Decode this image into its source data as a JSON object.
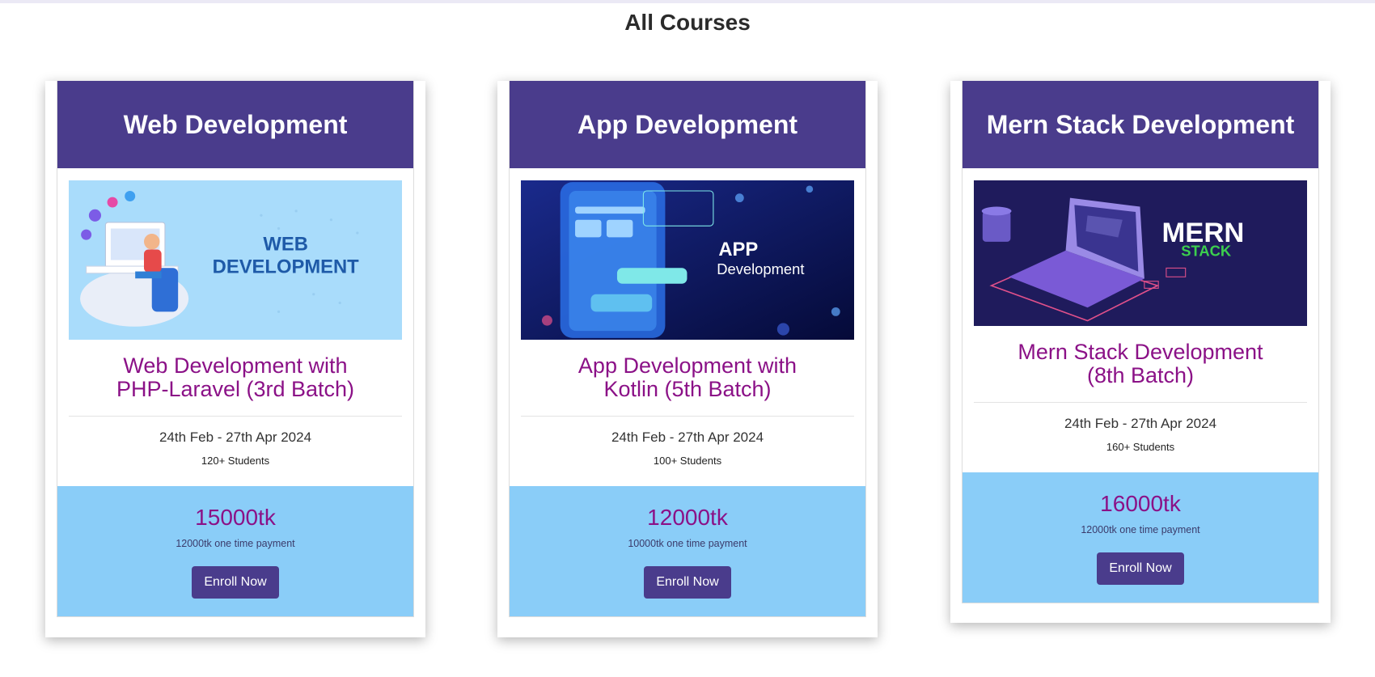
{
  "page": {
    "title": "All Courses"
  },
  "courses": [
    {
      "header": "Web Development",
      "banner": {
        "text_line1": "WEB",
        "text_line2": "DEVELOPMENT",
        "bg": "#a9dcfb",
        "text_color": "#1e5aa8"
      },
      "name_line1": "Web Development with",
      "name_line2": "PHP-Laravel (3rd Batch)",
      "dates": "24th Feb - 27th Apr 2024",
      "students": "120+ Students",
      "price": "15000tk",
      "payment": "12000tk one time payment",
      "enroll_label": "Enroll Now"
    },
    {
      "header": "App Development",
      "banner": {
        "text_line1": "APP",
        "text_line2": "Development",
        "bg": "#0a1450",
        "text_color": "#ffffff"
      },
      "name_line1": "App Development with",
      "name_line2": "Kotlin (5th Batch)",
      "dates": "24th Feb - 27th Apr 2024",
      "students": "100+ Students",
      "price": "12000tk",
      "payment": "10000tk one time payment",
      "enroll_label": "Enroll Now"
    },
    {
      "header": "Mern Stack Development",
      "banner": {
        "text_line1": "MERN",
        "text_line2": "STACK",
        "bg": "#1f1b5c",
        "text_color": "#ffffff"
      },
      "name_line1": "Mern Stack Development",
      "name_line2": "(8th Batch)",
      "dates": "24th Feb - 27th Apr 2024",
      "students": "160+ Students",
      "price": "16000tk",
      "payment": "12000tk one time payment",
      "enroll_label": "Enroll Now"
    }
  ],
  "colors": {
    "header_bg": "#4a3c8c",
    "price_bg": "#8acdf8",
    "accent_text": "#8b1187"
  }
}
